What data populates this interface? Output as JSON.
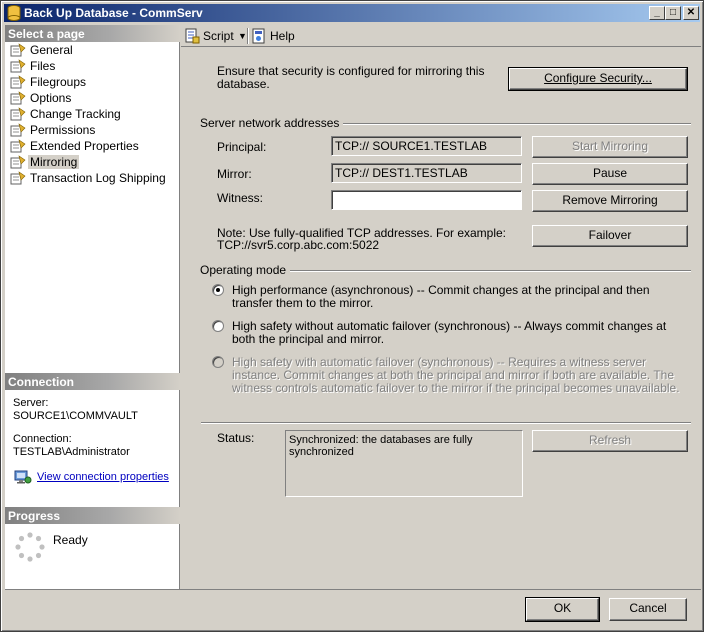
{
  "window": {
    "title": "Back Up Database - CommServ"
  },
  "titlebar_buttons": {
    "minimize": "_",
    "maximize": "□",
    "close": "✕"
  },
  "sidebar": {
    "select_page_header": "Select a page",
    "items": [
      {
        "label": "General"
      },
      {
        "label": "Files"
      },
      {
        "label": "Filegroups"
      },
      {
        "label": "Options"
      },
      {
        "label": "Change Tracking"
      },
      {
        "label": "Permissions"
      },
      {
        "label": "Extended Properties"
      },
      {
        "label": "Mirroring"
      },
      {
        "label": "Transaction Log Shipping"
      }
    ],
    "selected_item": "Mirroring",
    "connection_header": "Connection",
    "server_label": "Server:",
    "server_value": "SOURCE1\\COMMVAULT",
    "connection_label": "Connection:",
    "connection_value": "TESTLAB\\Administrator",
    "view_connection_link": "View connection properties",
    "progress_header": "Progress",
    "progress_status": "Ready"
  },
  "toolbar": {
    "script_label": "Script",
    "help_label": "Help"
  },
  "mirroring": {
    "security_note": "Ensure that security is configured for mirroring this database.",
    "configure_security_button": "Configure Security...",
    "network_group_label": "Server network addresses",
    "principal_label": "Principal:",
    "principal_value": "TCP:// SOURCE1.TESTLAB",
    "mirror_label": "Mirror:",
    "mirror_value": "TCP:// DEST1.TESTLAB",
    "witness_label": "Witness:",
    "witness_value": "",
    "start_mirroring_button": "Start Mirroring",
    "pause_button": "Pause",
    "remove_mirroring_button": "Remove Mirroring",
    "failover_button": "Failover",
    "address_note_line1": "Note: Use fully-qualified TCP addresses. For example:",
    "address_note_line2": "TCP://svr5.corp.abc.com:5022",
    "operating_mode_label": "Operating mode",
    "modes": [
      {
        "text": "High performance (asynchronous) -- Commit changes at the principal and then transfer them to the mirror.",
        "checked": true,
        "enabled": true
      },
      {
        "text": "High safety without automatic failover (synchronous) -- Always commit changes at both the principal and mirror.",
        "checked": false,
        "enabled": true
      },
      {
        "text": "High safety with automatic failover (synchronous) -- Requires a witness server instance. Commit changes at both the principal and mirror if both are available. The witness controls automatic failover to the mirror if the principal becomes unavailable.",
        "checked": false,
        "enabled": false
      }
    ],
    "status_label": "Status:",
    "status_value": "Synchronized: the databases are fully synchronized",
    "refresh_button": "Refresh"
  },
  "footer": {
    "ok_button": "OK",
    "cancel_button": "Cancel"
  }
}
